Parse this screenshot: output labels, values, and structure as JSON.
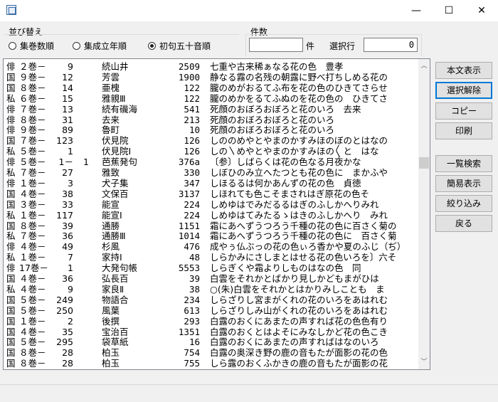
{
  "window": {
    "minimize": "—",
    "maximize": "☐",
    "close": "✕"
  },
  "sort": {
    "label": "並び替え",
    "options": [
      {
        "label": "集巻数順",
        "selected": false
      },
      {
        "label": "集成立年順",
        "selected": false
      },
      {
        "label": "初句五十音順",
        "selected": true
      }
    ]
  },
  "count": {
    "label": "件数",
    "value": "",
    "unit": "件",
    "selected_row_label": "選択行",
    "selected_row_value": "0"
  },
  "buttons": {
    "show_text": "本文表示",
    "clear_selection": "選択解除",
    "copy": "コピー",
    "print": "印刷",
    "list_search": "一覧検索",
    "simple_view": "簡易表示",
    "filter": "絞り込み",
    "back": "戻る"
  },
  "rows": [
    {
      "type": "俳",
      "vol": "２巻－",
      "num": "9",
      "sub": "",
      "src": "続山井",
      "cnt": "2509",
      "text": "七重や古来稀ぁなる花の色　豊孝"
    },
    {
      "type": "国",
      "vol": "９巻－",
      "num": "12",
      "sub": "",
      "src": "芳雲",
      "cnt": "1900",
      "text": "静なる霧の名残の朝露に野べ打ちしめる花の"
    },
    {
      "type": "国",
      "vol": "８巻－",
      "num": "14",
      "sub": "",
      "src": "亜槐",
      "cnt": "122",
      "text": "朧のめがおるてふ布を花の色のひきてさらせ"
    },
    {
      "type": "私",
      "vol": "６巻－",
      "num": "15",
      "sub": "",
      "src": "雅親Ⅲ",
      "cnt": "122",
      "text": "朧のめかをるてふぬのを花の色の　ひきてさ"
    },
    {
      "type": "俳",
      "vol": "７巻－",
      "num": "13",
      "sub": "",
      "src": "続有磯海",
      "cnt": "541",
      "text": "死顔のおぼろおぼろと花のいろ　去来"
    },
    {
      "type": "俳",
      "vol": "８巻－",
      "num": "31",
      "sub": "",
      "src": "去来",
      "cnt": "213",
      "text": "死顔のおぼろおぼろと花のいろ"
    },
    {
      "type": "俳",
      "vol": "９巻－",
      "num": "89",
      "sub": "",
      "src": "魯町",
      "cnt": "10",
      "text": "死顔のおぼろおぼろと花のいろ"
    },
    {
      "type": "国",
      "vol": "７巻－",
      "num": "123",
      "sub": "",
      "src": "伏見院",
      "cnt": "126",
      "text": "しののめやとやまのかすみほのぼのとはなの"
    },
    {
      "type": "私",
      "vol": "５巻－",
      "num": "1",
      "sub": "",
      "src": "伏見院Ⅰ",
      "cnt": "126",
      "text": "しの〵めやとやまのかすみほの〳〵と　はな"
    },
    {
      "type": "俳",
      "vol": "５巻－",
      "num": "1－",
      "sub": "1",
      "src": "芭蕉発句",
      "cnt": "376a",
      "text": "〔参〕しばらくは花の色なる月夜かな"
    },
    {
      "type": "私",
      "vol": "７巻－",
      "num": "27",
      "sub": "",
      "src": "雅致",
      "cnt": "330",
      "text": "しぼひのみ立へたつとも花の色に　まかふや"
    },
    {
      "type": "俳",
      "vol": "１巻－",
      "num": "3",
      "sub": "",
      "src": "犬子集",
      "cnt": "347",
      "text": "しほるるは何かあんずの花の色　貞徳"
    },
    {
      "type": "国",
      "vol": "４巻－",
      "num": "38",
      "sub": "",
      "src": "文保百",
      "cnt": "3137",
      "text": "しほれても色こそまされはぎ原花の色そ"
    },
    {
      "type": "国",
      "vol": "３巻－",
      "num": "33",
      "sub": "",
      "src": "能宣",
      "cnt": "224",
      "text": "しめゆはでみだるるはぎのふしかへりみれ"
    },
    {
      "type": "私",
      "vol": "１巻－",
      "num": "117",
      "sub": "",
      "src": "能宣Ⅰ",
      "cnt": "224",
      "text": "しめゆはてみたるゝはきのふしかへり　みれ"
    },
    {
      "type": "国",
      "vol": "８巻－",
      "num": "39",
      "sub": "",
      "src": "通勝",
      "cnt": "1151",
      "text": "霜にあへずうつろう千種の花の色に百さく菊の"
    },
    {
      "type": "私",
      "vol": "７巻－",
      "num": "36",
      "sub": "",
      "src": "通勝Ⅲ",
      "cnt": "1014",
      "text": "霜にあへずうつろう千種の花の色に　百さく菊"
    },
    {
      "type": "俳",
      "vol": "４巻－",
      "num": "49",
      "sub": "",
      "src": "杉風",
      "cnt": "476",
      "text": "成やぅ仏ぶっの花の色ぃろ香かや夏のふじ（ぢ）"
    },
    {
      "type": "私",
      "vol": "１巻－",
      "num": "7",
      "sub": "",
      "src": "家持Ⅰ",
      "cnt": "48",
      "text": "しらかみにさしまとはせる花の色いろを〕六そ"
    },
    {
      "type": "俳",
      "vol": "17巻－",
      "num": "1",
      "sub": "",
      "src": "大発句帳",
      "cnt": "5553",
      "text": "しらぎくや霜よりしものはなの色　同"
    },
    {
      "type": "国",
      "vol": "４巻－",
      "num": "36",
      "sub": "",
      "src": "弘長百",
      "cnt": "39",
      "text": "白雲をそれかとばかり見しかどもまがひは"
    },
    {
      "type": "私",
      "vol": "４巻－",
      "num": "9",
      "sub": "",
      "src": "家良Ⅱ",
      "cnt": "38",
      "text": "○(朱)白雲をそれかとはかりみしことも　ま"
    },
    {
      "type": "国",
      "vol": "５巻－",
      "num": "249",
      "sub": "",
      "src": "物語合",
      "cnt": "234",
      "text": "しらざりし宮まがくれの花のいろをあはれむ"
    },
    {
      "type": "国",
      "vol": "５巻－",
      "num": "250",
      "sub": "",
      "src": "風葉",
      "cnt": "613",
      "text": "しらざりしみ山がくれの花のいろをあはれむ"
    },
    {
      "type": "国",
      "vol": "１巻－",
      "num": "2",
      "sub": "",
      "src": "後撰",
      "cnt": "293",
      "text": "白露のおくにあまたの声すれば花の色色有り"
    },
    {
      "type": "国",
      "vol": "４巻－",
      "num": "35",
      "sub": "",
      "src": "宝治百",
      "cnt": "1351",
      "text": "白露のおくとはよそにみなしかど花の色こき"
    },
    {
      "type": "国",
      "vol": "５巻－",
      "num": "295",
      "sub": "",
      "src": "袋草紙",
      "cnt": "16",
      "text": "白露のおくにあまたの声すればはなのいろ"
    },
    {
      "type": "国",
      "vol": "８巻－",
      "num": "28",
      "sub": "",
      "src": "柏玉",
      "cnt": "754",
      "text": "白露の奥深き野の鹿の音もたが面影の花の色"
    },
    {
      "type": "国",
      "vol": "８巻－",
      "num": "28",
      "sub": "",
      "src": "柏玉",
      "cnt": "755",
      "text": "しら露のおくふかきの鹿の音もたが面影の花"
    }
  ]
}
